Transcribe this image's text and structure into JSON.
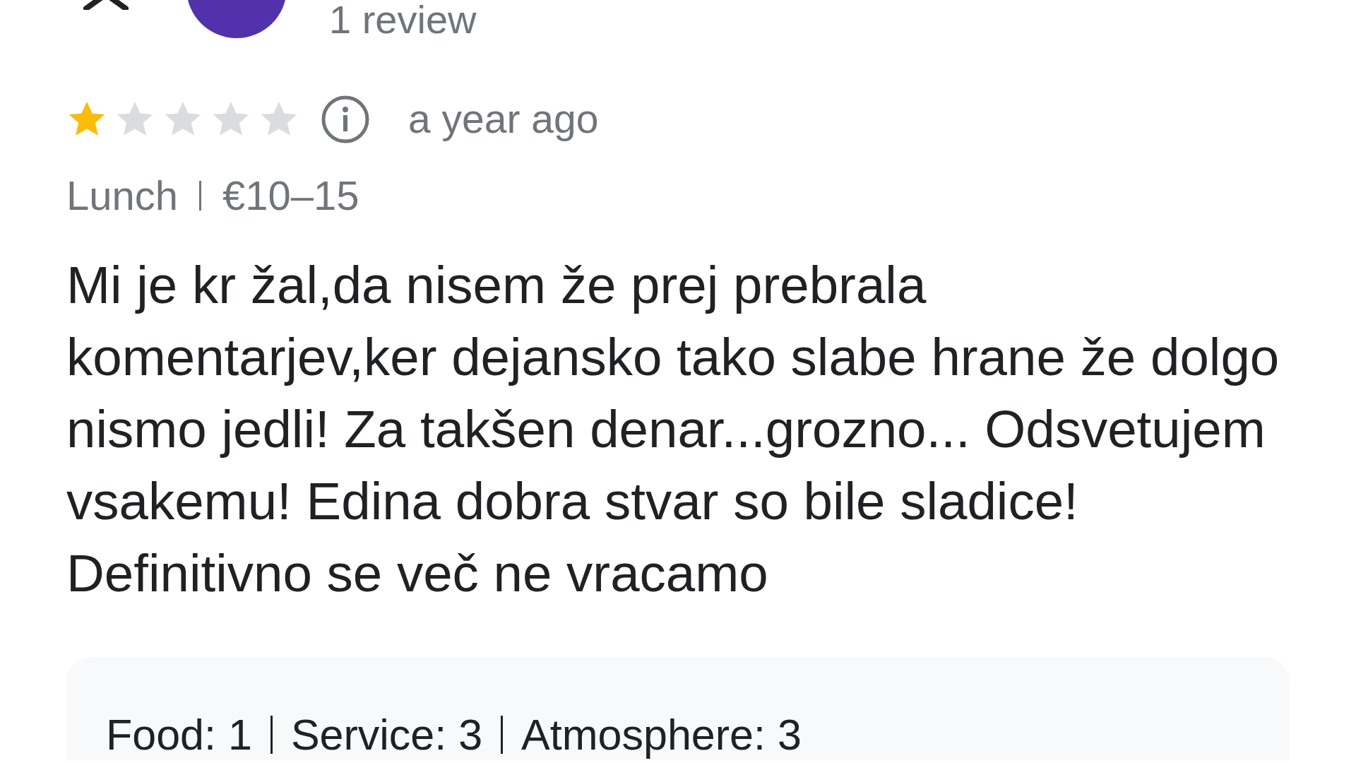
{
  "reviewer": {
    "review_count": "1 review"
  },
  "review": {
    "stars": 1,
    "time": "a year ago",
    "meta": [
      "Lunch",
      "€10–15"
    ],
    "text": "Mi je kr žal,da nisem že prej prebrala komentarjev,ker dejansko tako slabe hrane že dolgo nismo jedli! Za takšen denar...grozno... Odsvetujem vsakemu! Edina dobra stvar so bile sladice! Definitivno se več ne vracamo"
  },
  "ratings": [
    {
      "label": "Food:",
      "value": "1"
    },
    {
      "label": "Service:",
      "value": "3"
    },
    {
      "label": "Atmosphere:",
      "value": "3"
    }
  ]
}
